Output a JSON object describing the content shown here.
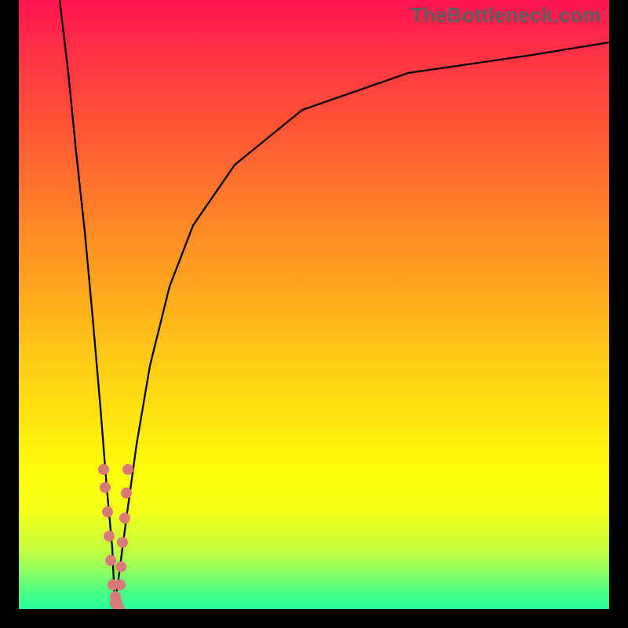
{
  "watermark": "TheBottleneck.com",
  "chart_data": {
    "type": "line",
    "title": "",
    "xlabel": "",
    "ylabel": "",
    "xlim": [
      0,
      100
    ],
    "ylim": [
      0,
      100
    ],
    "series": [
      {
        "name": "left-branch",
        "x": [
          7.0,
          8.2,
          9.6,
          11.0,
          12.4,
          13.8,
          14.9,
          15.7,
          16.1,
          16.2
        ],
        "values": [
          100,
          88,
          75,
          62,
          48,
          33,
          20,
          10,
          3,
          0
        ]
      },
      {
        "name": "right-branch",
        "x": [
          16.2,
          17.0,
          18.2,
          20.0,
          22.2,
          25.5,
          29.5,
          36.5,
          48.0,
          66.0,
          87.0,
          100.0
        ],
        "values": [
          0,
          6,
          15,
          27,
          40,
          53,
          63,
          73,
          82,
          88,
          91,
          93
        ]
      }
    ],
    "scatter": {
      "name": "data-points",
      "color": "#d97a79",
      "x": [
        14.3,
        14.6,
        15.0,
        15.3,
        15.6,
        16.0,
        16.3,
        17.1,
        17.3,
        17.6,
        17.9,
        18.2,
        18.5,
        16.5,
        16.9
      ],
      "values": [
        23,
        20,
        16,
        12,
        8,
        4,
        2,
        4,
        7,
        11,
        15,
        19,
        23,
        1,
        0
      ]
    },
    "background_gradient": {
      "top": "#ff1450",
      "mid": "#ffe80e",
      "bottom": "#24ff99"
    }
  }
}
